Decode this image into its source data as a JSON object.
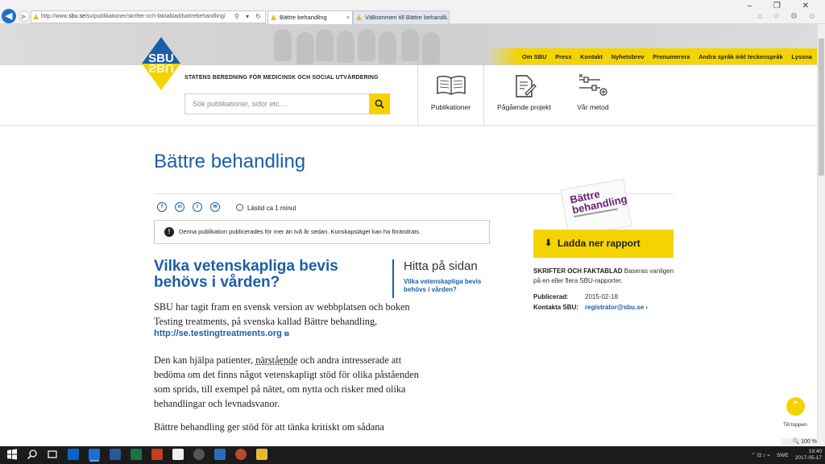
{
  "browser": {
    "url_prefix": "http://www.",
    "url_domain": "sbu.se",
    "url_path": "/sv/publikationer/skrifter-och-faktablad/battrebehandling/",
    "address_controls": "⚲ ▾ ↻",
    "tabs": [
      {
        "label": "Bättre behandling",
        "close": "×"
      },
      {
        "label": "Välkommen till Bättre behandli..."
      }
    ],
    "window_controls": "–  ❐  ✕",
    "toolbar_icons": "⌂ ☆ ⚙ ☺",
    "zoom": "🔍 100 %"
  },
  "site": {
    "logo_text": "SBU",
    "org_name": "STATENS BEREDNING FÖR MEDICINSK OCH SOCIAL UTVÄRDERING",
    "top_nav": [
      "Om SBU",
      "Press",
      "Kontakt",
      "Nyhetsbrev",
      "Prenumerera",
      "Andra språk inkl teckenspråk",
      "Lyssna"
    ],
    "search_placeholder": "Sök publikationer, sidor etc....",
    "main_nav": [
      "Publikationer",
      "Pågående projekt",
      "Vår metod"
    ]
  },
  "page": {
    "title": "Bättre behandling",
    "social": [
      "f",
      "in",
      "t",
      "✉"
    ],
    "read_time": "Lästid ca 1 minut",
    "notice": "Denna publikation publicerades för mer än två år sedan. Kunskapsläget kan ha förändrats.",
    "notice_icon": "!",
    "h2": "Vilka vetenskapliga bevis behövs i vården?",
    "p1": "SBU har tagit fram en svensk version av webbplatsen och boken Testing treatments, på svenska kallad Bättre behandling,",
    "link1": "http://se.testingtreatments.org",
    "link1_icon": "⧉",
    "p2_a": "Den kan hjälpa patienter, ",
    "p2_link": "närstående",
    "p2_b": " och andra intresserade att bedöma om det finns något vetenskapligt stöd för olika påståenden som sprids, till exempel på nätet, om nytta och risker med olika behandlingar och levnadsvanor.",
    "p3": "Bättre behandling ger stöd för att tänka kritiskt om sådana",
    "toc_heading": "Hitta på sidan",
    "toc_link": "Vilka vetenskapliga bevis behövs i vården?"
  },
  "sidebar": {
    "cover_title": "Bättre behandling",
    "download_label": "Ladda ner rapport",
    "download_icon": "⬇",
    "type_label": "SKRIFTER OCH FAKTABLAD",
    "type_desc": " Baseras vanligen på en eller flera SBU-rapporter.",
    "published_label": "Publicerad:",
    "published_value": "2015-02-18",
    "contact_label": "Kontakta SBU:",
    "contact_value": "registrator@sbu.se ›"
  },
  "to_top": {
    "icon": "⌃",
    "label": "Till toppen"
  },
  "taskbar": {
    "lang": "SWE",
    "time": "19:40",
    "date": "2017-05-17",
    "tray_icons": "⌃ ⊡ ♪ ⌁"
  },
  "colors": {
    "accent_blue": "#1a5ea8",
    "accent_yellow": "#f4d400"
  }
}
